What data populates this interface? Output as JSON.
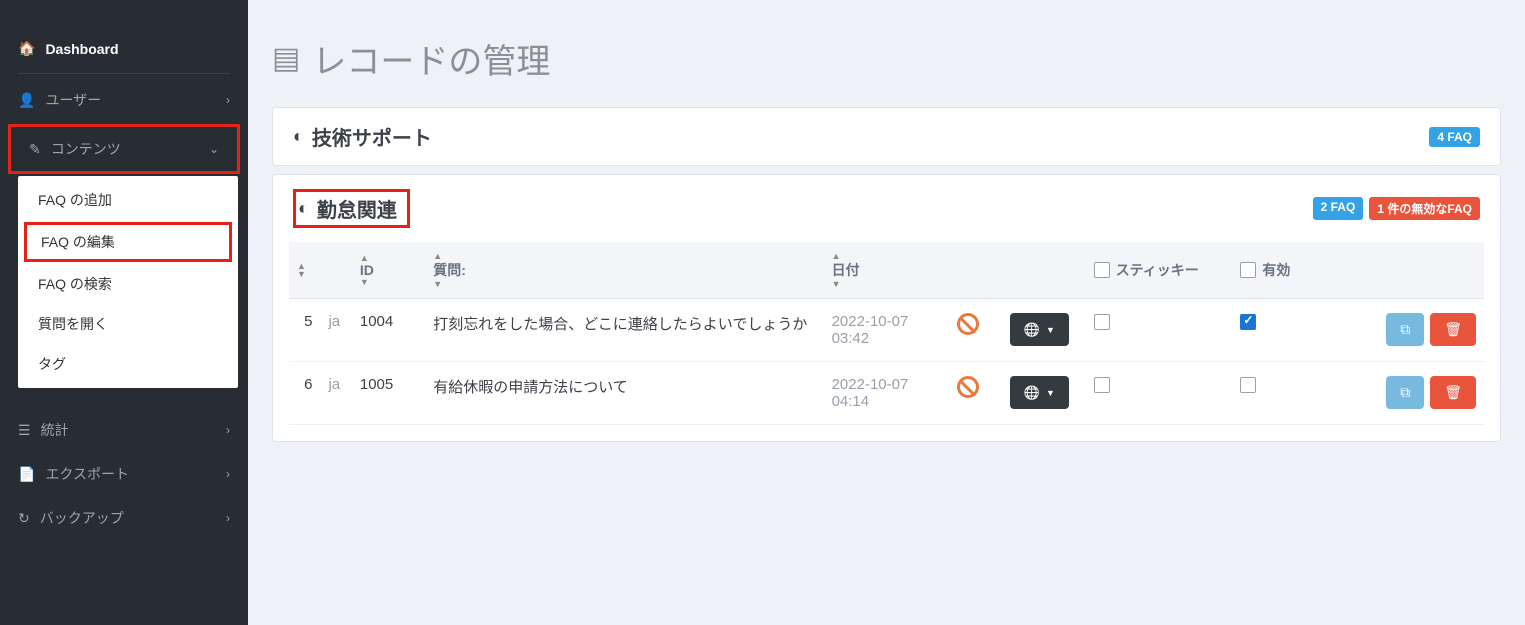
{
  "sidebar": {
    "dashboard": "Dashboard",
    "items": {
      "user": "ユーザー",
      "contents": "コンテンツ",
      "stats": "統計",
      "export": "エクスポート",
      "backup": "バックアップ"
    },
    "submenu": {
      "add_faq": "FAQ の追加",
      "edit_faq": "FAQ の編集",
      "search_faq": "FAQ の検索",
      "open_question": "質問を開く",
      "tag": "タグ"
    }
  },
  "page": {
    "title": "レコードの管理"
  },
  "sections": [
    {
      "title": "技術サポート",
      "badge_faq": "4 FAQ",
      "badge_invalid": null
    },
    {
      "title": "勤怠関連",
      "badge_faq": "2 FAQ",
      "badge_invalid": "1 件の無効なFAQ"
    }
  ],
  "columns": {
    "id": "ID",
    "question": "質問:",
    "date": "日付",
    "sticky": "スティッキー",
    "enabled": "有効"
  },
  "rows": [
    {
      "n": "5",
      "lang": "ja",
      "id": "1004",
      "question": "打刻忘れをした場合、どこに連絡したらよいでしょうか",
      "date": "2022-10-07 03:42",
      "sticky": false,
      "enabled": true
    },
    {
      "n": "6",
      "lang": "ja",
      "id": "1005",
      "question": "有給休暇の申請方法について",
      "date": "2022-10-07 04:14",
      "sticky": false,
      "enabled": false
    }
  ]
}
